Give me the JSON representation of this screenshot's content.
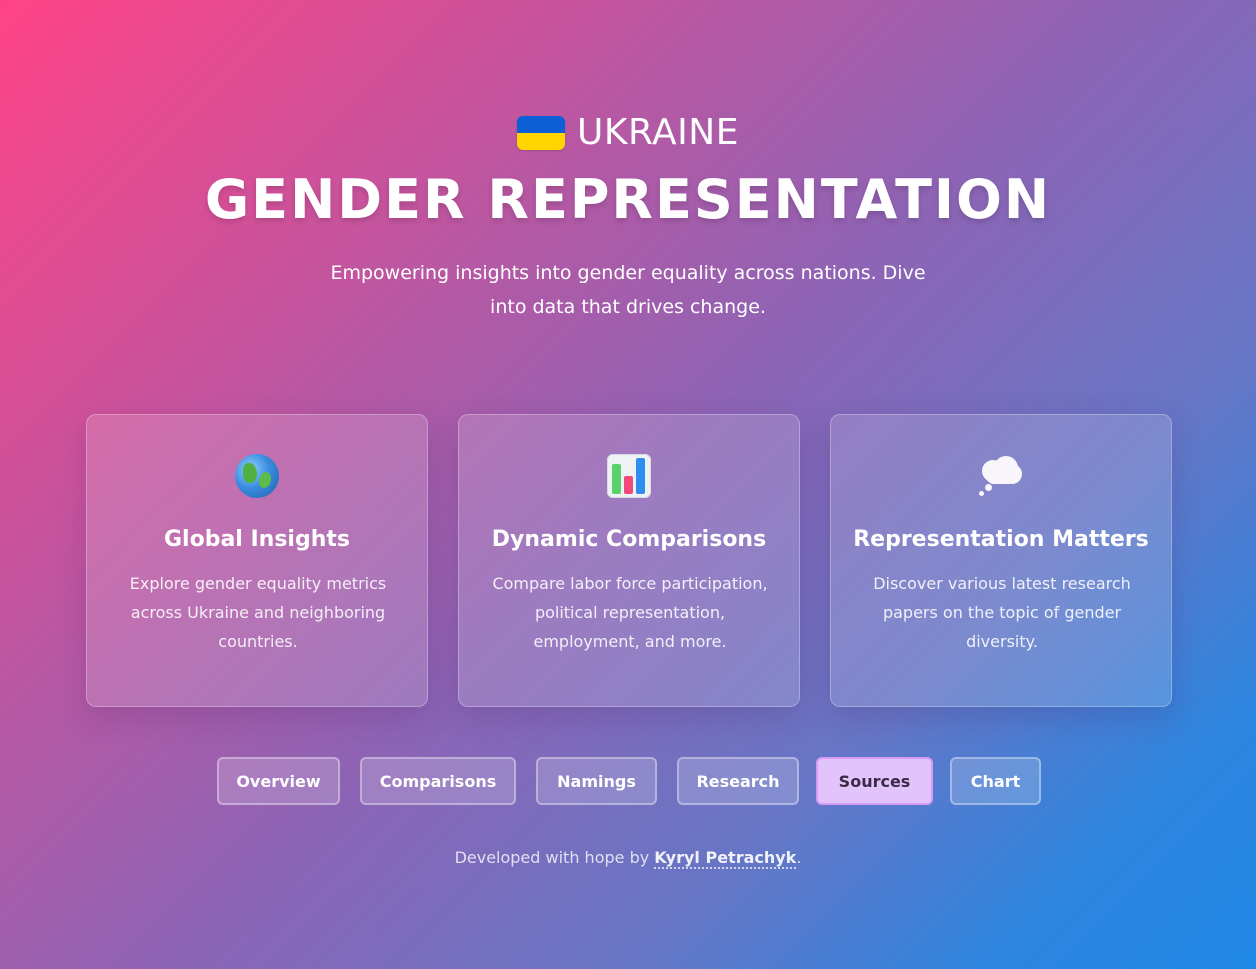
{
  "header": {
    "country": "UKRAINE",
    "title": "GENDER REPRESENTATION",
    "subtitle": "Empowering insights into gender equality across nations. Dive into data that drives change."
  },
  "colors": {
    "flag_blue": "#0c5fd6",
    "flag_yellow": "#ffd500",
    "active_button_bg": "#e3c3fb",
    "gradient_start": "#ff4385",
    "gradient_end": "#1e88e5"
  },
  "cards": [
    {
      "icon": "globe-icon",
      "title": "Global Insights",
      "text": "Explore gender equality metrics across Ukraine and neighboring countries."
    },
    {
      "icon": "bar-chart-icon",
      "title": "Dynamic Comparisons",
      "text": "Compare labor force participation, political representation, employment, and more."
    },
    {
      "icon": "thought-bubble-icon",
      "title": "Representation Matters",
      "text": "Discover various latest research papers on the topic of gender diversity."
    }
  ],
  "nav": {
    "overview": "Overview",
    "comparisons": "Comparisons",
    "namings": "Namings",
    "research": "Research",
    "sources": "Sources",
    "chart": "Chart",
    "active": "Sources"
  },
  "footer": {
    "prefix": "Developed with hope by ",
    "author": "Kyryl Petrachyk",
    "suffix": "."
  }
}
